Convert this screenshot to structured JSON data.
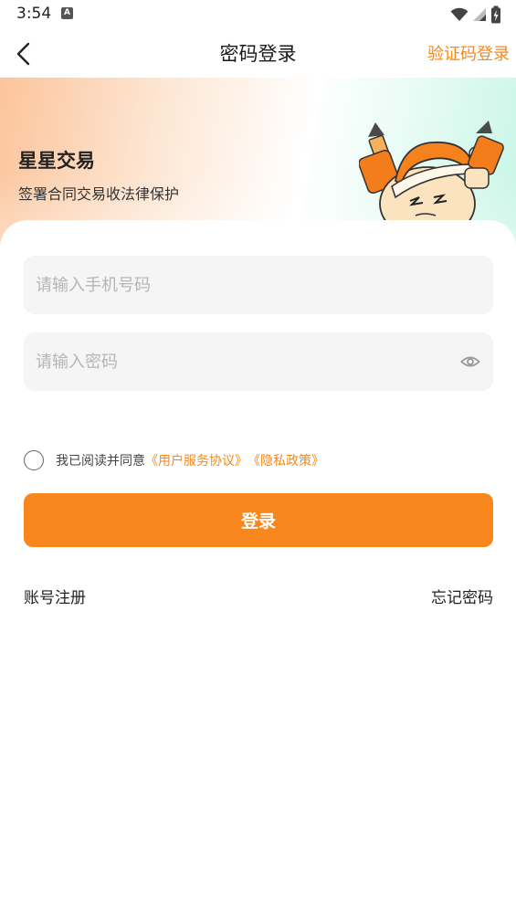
{
  "status_bar": {
    "time": "3:54",
    "notification_icon_letter": "A"
  },
  "nav": {
    "title": "密码登录",
    "switch_link": "验证码登录"
  },
  "hero": {
    "title": "星星交易",
    "subtitle": "签署合同交易收法律保护"
  },
  "form": {
    "phone_placeholder": "请输入手机号码",
    "password_placeholder": "请输入密码"
  },
  "agreement": {
    "prefix": "我已阅读并同意",
    "user_agreement": "《用户服务协议》",
    "privacy_policy": "《隐私政策》",
    "checked": false
  },
  "login_button": "登录",
  "footer": {
    "register": "账号注册",
    "forgot_password": "忘记密码"
  },
  "colors": {
    "accent": "#f7871c",
    "field_bg": "#f5f5f5",
    "placeholder": "#b5b5b5"
  }
}
